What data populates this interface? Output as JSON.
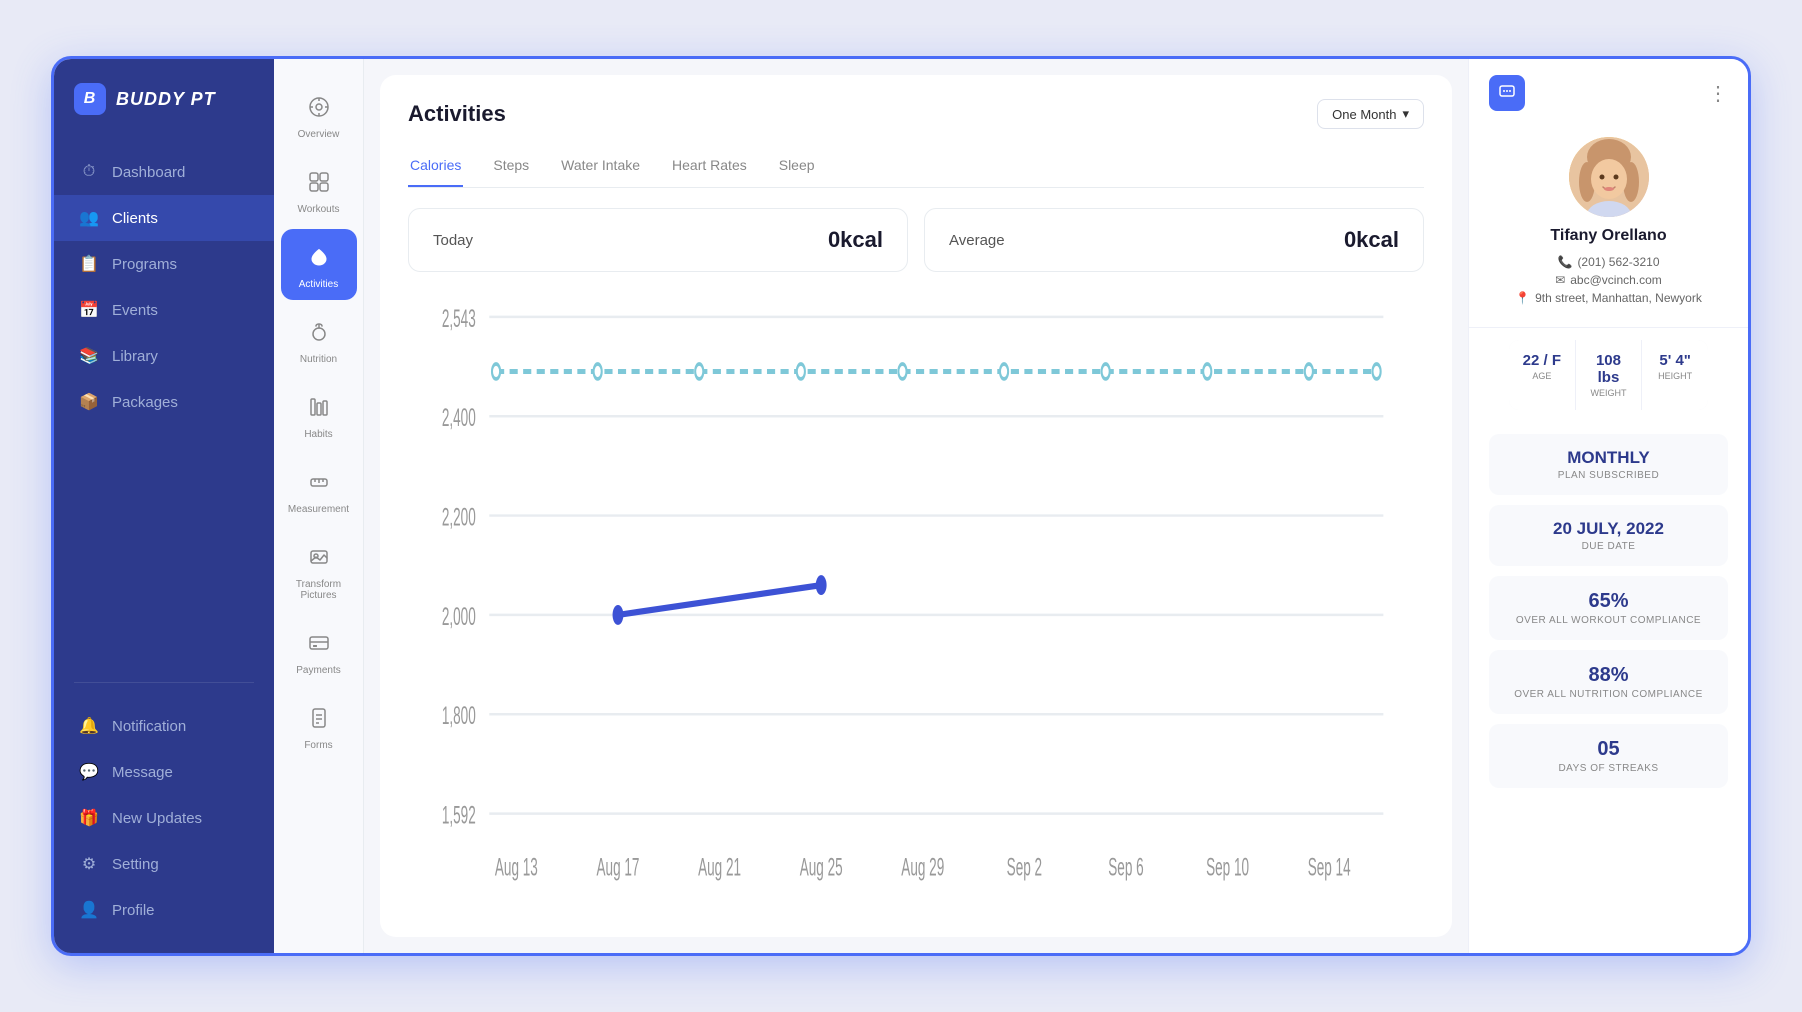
{
  "app": {
    "name": "BUDDY PT",
    "logo_letter": "B"
  },
  "sidebar": {
    "nav_items": [
      {
        "id": "dashboard",
        "label": "Dashboard",
        "icon": "⏱"
      },
      {
        "id": "clients",
        "label": "Clients",
        "icon": "👥",
        "active": true
      },
      {
        "id": "programs",
        "label": "Programs",
        "icon": "📋"
      },
      {
        "id": "events",
        "label": "Events",
        "icon": "📅"
      },
      {
        "id": "library",
        "label": "Library",
        "icon": "📚"
      },
      {
        "id": "packages",
        "label": "Packages",
        "icon": "📦"
      }
    ],
    "bottom_items": [
      {
        "id": "notification",
        "label": "Notification",
        "icon": "🔔"
      },
      {
        "id": "message",
        "label": "Message",
        "icon": "💬"
      },
      {
        "id": "new-updates",
        "label": "New Updates",
        "icon": "🎁"
      },
      {
        "id": "setting",
        "label": "Setting",
        "icon": "⚙"
      },
      {
        "id": "profile",
        "label": "Profile",
        "icon": "👤"
      }
    ]
  },
  "icon_nav": {
    "items": [
      {
        "id": "overview",
        "label": "Overview",
        "icon": "◎"
      },
      {
        "id": "workouts",
        "label": "Workouts",
        "icon": "⊞"
      },
      {
        "id": "activities",
        "label": "Activities",
        "icon": "❤",
        "active": true
      },
      {
        "id": "nutrition",
        "label": "Nutrition",
        "icon": "🥗"
      },
      {
        "id": "habits",
        "label": "Habits",
        "icon": "📊"
      },
      {
        "id": "measurement",
        "label": "Measurement",
        "icon": "📏"
      },
      {
        "id": "transform-pictures",
        "label": "Transform Pictures",
        "icon": "🖼"
      },
      {
        "id": "payments",
        "label": "Payments",
        "icon": "💳"
      },
      {
        "id": "forms",
        "label": "Forms",
        "icon": "📄"
      }
    ]
  },
  "activities": {
    "title": "Activities",
    "time_filter": "One Month",
    "tabs": [
      {
        "id": "calories",
        "label": "Calories",
        "active": true
      },
      {
        "id": "steps",
        "label": "Steps"
      },
      {
        "id": "water-intake",
        "label": "Water Intake"
      },
      {
        "id": "heart-rates",
        "label": "Heart Rates"
      },
      {
        "id": "sleep",
        "label": "Sleep"
      }
    ],
    "today_label": "Today",
    "today_value": "0kcal",
    "average_label": "Average",
    "average_value": "0kcal",
    "chart": {
      "y_labels": [
        "2,543",
        "2,400",
        "2,200",
        "2,000",
        "1,800",
        "1,592"
      ],
      "x_labels": [
        "Aug 13",
        "Aug 17",
        "Aug 21",
        "Aug 25",
        "Aug 29",
        "Sep 2",
        "Sep 6",
        "Sep 10",
        "Sep 14"
      ]
    }
  },
  "profile": {
    "name": "Tifany Orellano",
    "phone": "(201) 562-3210",
    "email": "abc@vcinch.com",
    "address": "9th street, Manhattan, Newyork",
    "age": "22 / F",
    "weight": "108 lbs",
    "height": "5' 4\"",
    "age_label": "AGE",
    "weight_label": "WEIGHT",
    "height_label": "HEIGHT",
    "plan": "MONTHLY",
    "plan_label": "PLAN SUBSCRIBED",
    "due_date": "20 JULY, 2022",
    "due_date_label": "DUE DATE",
    "workout_compliance": "65%",
    "workout_compliance_label": "OVER ALL WORKOUT COMPLIANCE",
    "nutrition_compliance": "88%",
    "nutrition_compliance_label": "OVER ALL NUTRITION COMPLIANCE",
    "streaks": "05",
    "streaks_label": "DAYS OF STREAKS"
  }
}
